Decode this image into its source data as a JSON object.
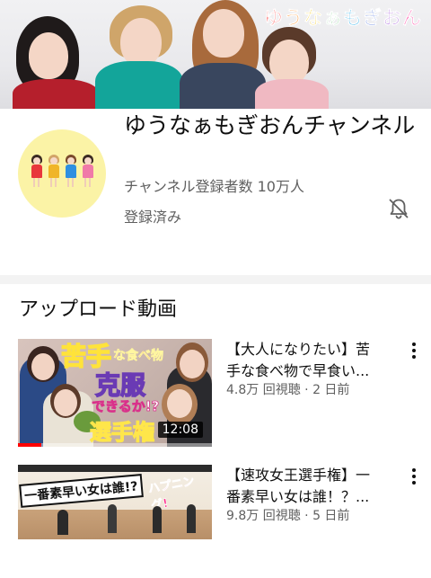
{
  "banner": {
    "logo_chars": [
      {
        "ch": "ゆ",
        "color": "#ff3b3b"
      },
      {
        "ch": "う",
        "color": "#ff8a1e"
      },
      {
        "ch": "な",
        "color": "#f5c400"
      },
      {
        "ch": "ぁ",
        "color": "#36b24a"
      },
      {
        "ch": "も",
        "color": "#1aa7e8"
      },
      {
        "ch": "ぎ",
        "color": "#3a62d8"
      },
      {
        "ch": "お",
        "color": "#9a4bd6"
      },
      {
        "ch": "ん",
        "color": "#ff3fa0"
      }
    ]
  },
  "channel": {
    "name": "ゆうなぁもぎおんチャンネル",
    "subscribers": "チャンネル登録者数 10万人",
    "subscribed_label": "登録済み"
  },
  "uploads": {
    "section_title": "アップロード動画",
    "videos": [
      {
        "title": "【大人になりたい】苦手な食べ物で早食い...",
        "title_line1": "【大人になりたい】苦",
        "title_line2": "手な食べ物で早食い...",
        "views": "4.8万 回視聴",
        "age": "2 日前",
        "duration": "12:08",
        "progress": 0.12,
        "thumb_text_1": "苦手",
        "thumb_text_2": "な食べ物",
        "thumb_text_3": "克服",
        "thumb_text_4": "できるか!?",
        "thumb_text_5": "選手権"
      },
      {
        "title": "【速攻女王選手権】一番素早い女は誰！？...",
        "title_line1": "【速攻女王選手権】一",
        "title_line2": "番素早い女は誰！？...",
        "views": "9.8万 回視聴",
        "age": "5 日前",
        "thumb_text_1": "一番素早い女は誰!?",
        "thumb_text_2": "ハプニング!"
      }
    ]
  },
  "icons": {
    "bell": "bell-off-icon",
    "more": "more-vert-icon"
  }
}
